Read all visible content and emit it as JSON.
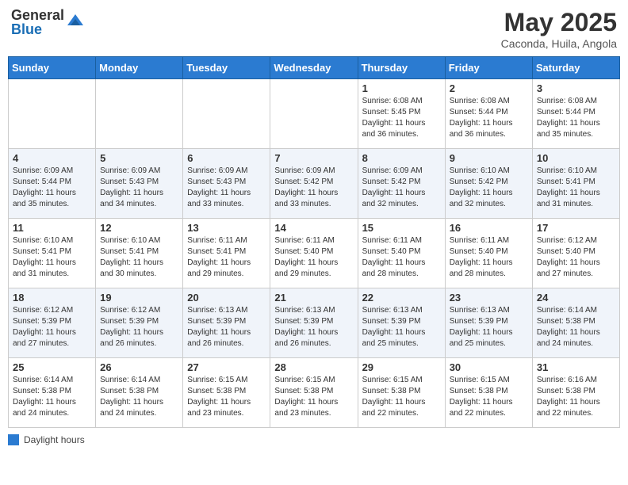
{
  "header": {
    "logo_general": "General",
    "logo_blue": "Blue",
    "month_title": "May 2025",
    "location": "Caconda, Huila, Angola"
  },
  "days_of_week": [
    "Sunday",
    "Monday",
    "Tuesday",
    "Wednesday",
    "Thursday",
    "Friday",
    "Saturday"
  ],
  "legend_label": "Daylight hours",
  "weeks": [
    [
      {
        "day": "",
        "info": ""
      },
      {
        "day": "",
        "info": ""
      },
      {
        "day": "",
        "info": ""
      },
      {
        "day": "",
        "info": ""
      },
      {
        "day": "1",
        "info": "Sunrise: 6:08 AM\nSunset: 5:45 PM\nDaylight: 11 hours and 36 minutes."
      },
      {
        "day": "2",
        "info": "Sunrise: 6:08 AM\nSunset: 5:44 PM\nDaylight: 11 hours and 36 minutes."
      },
      {
        "day": "3",
        "info": "Sunrise: 6:08 AM\nSunset: 5:44 PM\nDaylight: 11 hours and 35 minutes."
      }
    ],
    [
      {
        "day": "4",
        "info": "Sunrise: 6:09 AM\nSunset: 5:44 PM\nDaylight: 11 hours and 35 minutes."
      },
      {
        "day": "5",
        "info": "Sunrise: 6:09 AM\nSunset: 5:43 PM\nDaylight: 11 hours and 34 minutes."
      },
      {
        "day": "6",
        "info": "Sunrise: 6:09 AM\nSunset: 5:43 PM\nDaylight: 11 hours and 33 minutes."
      },
      {
        "day": "7",
        "info": "Sunrise: 6:09 AM\nSunset: 5:42 PM\nDaylight: 11 hours and 33 minutes."
      },
      {
        "day": "8",
        "info": "Sunrise: 6:09 AM\nSunset: 5:42 PM\nDaylight: 11 hours and 32 minutes."
      },
      {
        "day": "9",
        "info": "Sunrise: 6:10 AM\nSunset: 5:42 PM\nDaylight: 11 hours and 32 minutes."
      },
      {
        "day": "10",
        "info": "Sunrise: 6:10 AM\nSunset: 5:41 PM\nDaylight: 11 hours and 31 minutes."
      }
    ],
    [
      {
        "day": "11",
        "info": "Sunrise: 6:10 AM\nSunset: 5:41 PM\nDaylight: 11 hours and 31 minutes."
      },
      {
        "day": "12",
        "info": "Sunrise: 6:10 AM\nSunset: 5:41 PM\nDaylight: 11 hours and 30 minutes."
      },
      {
        "day": "13",
        "info": "Sunrise: 6:11 AM\nSunset: 5:41 PM\nDaylight: 11 hours and 29 minutes."
      },
      {
        "day": "14",
        "info": "Sunrise: 6:11 AM\nSunset: 5:40 PM\nDaylight: 11 hours and 29 minutes."
      },
      {
        "day": "15",
        "info": "Sunrise: 6:11 AM\nSunset: 5:40 PM\nDaylight: 11 hours and 28 minutes."
      },
      {
        "day": "16",
        "info": "Sunrise: 6:11 AM\nSunset: 5:40 PM\nDaylight: 11 hours and 28 minutes."
      },
      {
        "day": "17",
        "info": "Sunrise: 6:12 AM\nSunset: 5:40 PM\nDaylight: 11 hours and 27 minutes."
      }
    ],
    [
      {
        "day": "18",
        "info": "Sunrise: 6:12 AM\nSunset: 5:39 PM\nDaylight: 11 hours and 27 minutes."
      },
      {
        "day": "19",
        "info": "Sunrise: 6:12 AM\nSunset: 5:39 PM\nDaylight: 11 hours and 26 minutes."
      },
      {
        "day": "20",
        "info": "Sunrise: 6:13 AM\nSunset: 5:39 PM\nDaylight: 11 hours and 26 minutes."
      },
      {
        "day": "21",
        "info": "Sunrise: 6:13 AM\nSunset: 5:39 PM\nDaylight: 11 hours and 26 minutes."
      },
      {
        "day": "22",
        "info": "Sunrise: 6:13 AM\nSunset: 5:39 PM\nDaylight: 11 hours and 25 minutes."
      },
      {
        "day": "23",
        "info": "Sunrise: 6:13 AM\nSunset: 5:39 PM\nDaylight: 11 hours and 25 minutes."
      },
      {
        "day": "24",
        "info": "Sunrise: 6:14 AM\nSunset: 5:38 PM\nDaylight: 11 hours and 24 minutes."
      }
    ],
    [
      {
        "day": "25",
        "info": "Sunrise: 6:14 AM\nSunset: 5:38 PM\nDaylight: 11 hours and 24 minutes."
      },
      {
        "day": "26",
        "info": "Sunrise: 6:14 AM\nSunset: 5:38 PM\nDaylight: 11 hours and 24 minutes."
      },
      {
        "day": "27",
        "info": "Sunrise: 6:15 AM\nSunset: 5:38 PM\nDaylight: 11 hours and 23 minutes."
      },
      {
        "day": "28",
        "info": "Sunrise: 6:15 AM\nSunset: 5:38 PM\nDaylight: 11 hours and 23 minutes."
      },
      {
        "day": "29",
        "info": "Sunrise: 6:15 AM\nSunset: 5:38 PM\nDaylight: 11 hours and 22 minutes."
      },
      {
        "day": "30",
        "info": "Sunrise: 6:15 AM\nSunset: 5:38 PM\nDaylight: 11 hours and 22 minutes."
      },
      {
        "day": "31",
        "info": "Sunrise: 6:16 AM\nSunset: 5:38 PM\nDaylight: 11 hours and 22 minutes."
      }
    ]
  ]
}
